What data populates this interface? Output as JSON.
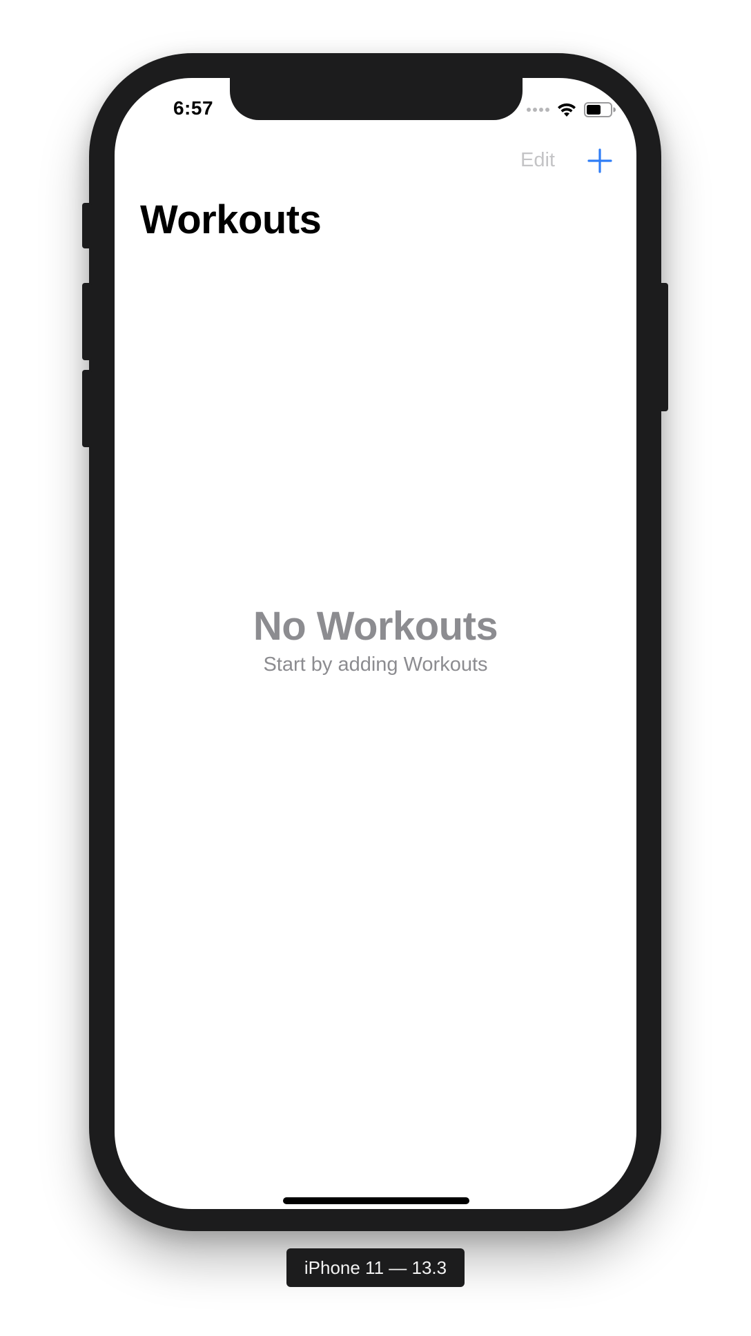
{
  "status_bar": {
    "time": "6:57",
    "icons": [
      "cellular-signal-icon",
      "wifi-icon",
      "battery-icon"
    ]
  },
  "nav_bar": {
    "edit_label": "Edit",
    "add_icon": "plus-icon",
    "title": "Workouts"
  },
  "empty_state": {
    "title": "No Workouts",
    "subtitle": "Start by adding Workouts"
  },
  "device_caption": "iPhone 11 — 13.3",
  "colors": {
    "accent": "#2f7df6",
    "disabled": "#c4c4c6",
    "secondary_text": "#8c8c90",
    "frame": "#1c1c1d"
  }
}
